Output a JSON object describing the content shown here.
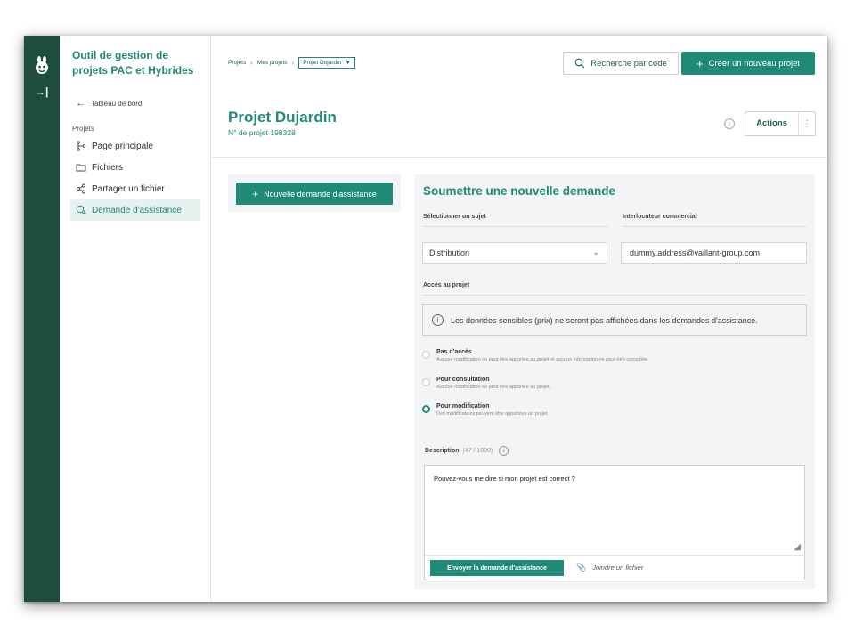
{
  "app": {
    "title": "Outil de gestion de projets PAC et Hybrides",
    "brand_color": "#1f8a76",
    "rail_color": "#1e4d3f",
    "logo_icon": "rabbit-logo-icon",
    "collapse_icon": "sidebar-expand-icon"
  },
  "sidebar": {
    "back_label": "Tableau de bord",
    "section_label": "Projets",
    "items": [
      {
        "label": "Page principale",
        "icon": "branch-icon",
        "active": false
      },
      {
        "label": "Fichiers",
        "icon": "folder-icon",
        "active": false
      },
      {
        "label": "Partager un fichier",
        "icon": "share-icon",
        "active": false
      },
      {
        "label": "Demande d'assistance",
        "icon": "chat-icon",
        "active": true
      }
    ]
  },
  "breadcrumb": {
    "items": [
      "Projets",
      "Mes projets"
    ],
    "selected_project": "Projet Dujardin"
  },
  "header": {
    "search_label": "Recherche par code",
    "create_label": "Créer un nouveau projet",
    "project_title": "Projet Dujardin",
    "project_number": "N° de projet 198328",
    "actions_label": "Actions"
  },
  "left": {
    "new_request_label": "Nouvelle demande d'assistance"
  },
  "form": {
    "title": "Soumettre une nouvelle demande",
    "subject_label": "Sélectionner un sujet",
    "subject_value": "Distribution",
    "contact_label": "Interlocuteur commercial",
    "contact_value": "dummy.address@vaillant-group.com",
    "access_label": "Accès au projet",
    "notice": "Les données sensibles (prix) ne seront pas affichées dans les demandes d'assistance.",
    "radios": [
      {
        "title": "Pas d'accès",
        "desc": "Aucune modification ne peut être apportée au projet et aucune information ne peut être consultée.",
        "checked": false
      },
      {
        "title": "Pour consultation",
        "desc": "Aucune modification ne peut être apportée au projet.",
        "checked": false
      },
      {
        "title": "Pour modification",
        "desc": "Des modifications peuvent être apportées au projet.",
        "checked": true
      }
    ],
    "description_label": "Description",
    "description_count": "(47 / 1000)",
    "description_value": "Pouvez-vous me dire si mon projet est correct ?",
    "send_label": "Envoyer la demande d'assistance",
    "attach_label": "Joindre un fichier"
  }
}
